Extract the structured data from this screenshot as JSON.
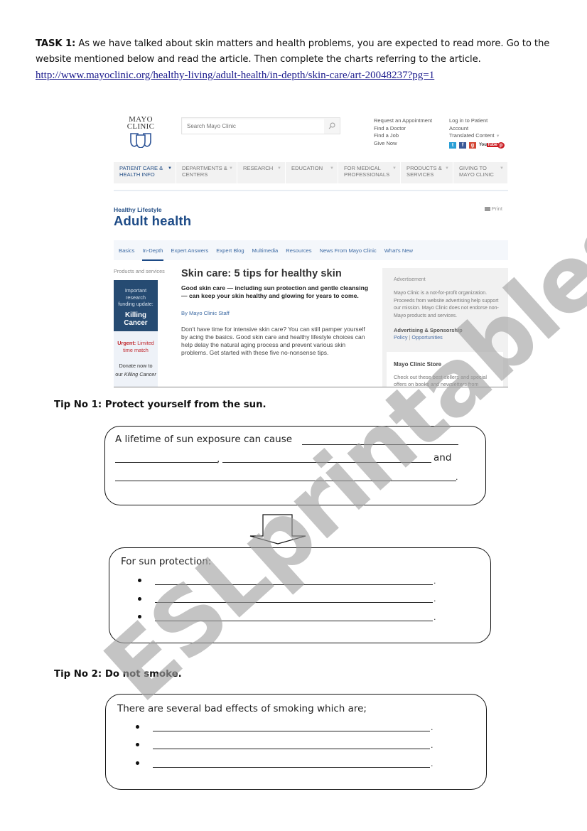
{
  "task": {
    "label": "TASK 1:",
    "instructions": " As we have talked about skin matters and health problems, you are expected to read more. Go to the website mentioned below and read the article. Then complete the charts referring to the article.",
    "url": "http://www.mayoclinic.org/healthy-living/adult-health/in-depth/skin-care/art-20048237?pg=1"
  },
  "website": {
    "logo": {
      "line1": "MAYO",
      "line2": "CLINIC"
    },
    "search": {
      "placeholder": "Search Mayo Clinic",
      "icon": "search-icon"
    },
    "utility_links_left": [
      "Request an Appointment",
      "Find a Doctor",
      "Find a Job",
      "Give Now"
    ],
    "utility_links_right": [
      "Log in to Patient",
      "Account",
      "Translated Content"
    ],
    "social_icons": [
      "twitter-icon",
      "facebook-icon",
      "google-plus-icon",
      "youtube-icon",
      "pinterest-icon"
    ],
    "youtube_label": {
      "you": "You",
      "tube": "Tube"
    },
    "main_nav": [
      {
        "line1": "Patient Care &",
        "line2": "Health Info",
        "active": true
      },
      {
        "line1": "Departments &",
        "line2": "Centers",
        "active": false
      },
      {
        "line1": "Research",
        "line2": "",
        "active": false
      },
      {
        "line1": "Education",
        "line2": "",
        "active": false
      },
      {
        "line1": "For Medical",
        "line2": "Professionals",
        "active": false
      },
      {
        "line1": "Products &",
        "line2": "Services",
        "active": false
      },
      {
        "line1": "Giving to",
        "line2": "Mayo Clinic",
        "active": false
      }
    ],
    "kicker": "Healthy Lifestyle",
    "page_title": "Adult health",
    "print_label": "Print",
    "sub_nav": [
      {
        "label": "Basics",
        "active": false
      },
      {
        "label": "In-Depth",
        "active": true
      },
      {
        "label": "Expert Answers",
        "active": false
      },
      {
        "label": "Expert Blog",
        "active": false
      },
      {
        "label": "Multimedia",
        "active": false
      },
      {
        "label": "Resources",
        "active": false
      },
      {
        "label": "News From Mayo Clinic",
        "active": false
      },
      {
        "label": "What's New",
        "active": false
      }
    ],
    "left_col": {
      "label": "Products and services",
      "promo_line1": "Important research",
      "promo_line2": "funding update:",
      "promo_title": "Killing Cancer",
      "urgent_bold": "Urgent:",
      "urgent_rest": " Limited time match",
      "donate_line": "Donate now to",
      "donate_prefix": "our ",
      "donate_em": "Killing Cancer"
    },
    "article": {
      "title": "Skin care: 5 tips for healthy skin",
      "lead": "Good skin care — including sun protection and gentle cleansing — can keep your skin healthy and glowing for years to come.",
      "byline": "By Mayo Clinic Staff",
      "body": "Don't have time for intensive skin care? You can still pamper yourself by acing the basics. Good skin care and healthy lifestyle choices can help delay the natural aging process and prevent various skin problems. Get started with these five no-nonsense tips."
    },
    "right_col": {
      "ad_label": "Advertisement",
      "ad_text": "Mayo Clinic is a not-for-profit organization. Proceeds from website advertising help support our mission. Mayo Clinic does not endorse non-Mayo products and services.",
      "ad_sponsor_title": "Advertising & Sponsorship",
      "ad_link_policy": "Policy",
      "ad_link_sep": " | ",
      "ad_link_opps": "Opportunities",
      "store_title": "Mayo Clinic Store",
      "store_text": "Check out these best-sellers and special offers on books and newsletters from"
    }
  },
  "worksheet": {
    "tip1": {
      "heading": "Tip No 1: Protect yourself from the sun.",
      "box_prompt": "A lifetime of sun exposure can cause",
      "comma": ",",
      "and": "and",
      "period": ".",
      "arrow_icon": "down-arrow-icon",
      "protection_label": "For sun protection:",
      "protection_blanks": [
        ".",
        ".",
        "."
      ]
    },
    "tip2": {
      "heading": "Tip No 2: Do not smoke.",
      "box_prompt": "There are several bad effects of smoking which are;",
      "blanks": [
        ".",
        ".",
        "."
      ]
    }
  },
  "watermark": "ESLprintables.com"
}
